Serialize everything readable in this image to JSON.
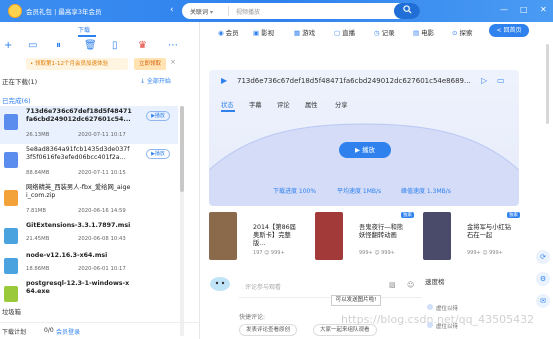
{
  "titlebar": {
    "vip_text": "会员礼包 | 最高享3年会员",
    "search_category": "关联词",
    "search_placeholder": "视频播放",
    "search_icon": "magnifier-icon",
    "min": "—",
    "max": "□",
    "close": "✕"
  },
  "left": {
    "download_tab": "下载",
    "promo_text": "• 领取第1-12个月会员加速体验",
    "promo_button": "立即领取",
    "downloading_label": "正在下载(1)",
    "start_all": "↓ 全部开始",
    "completed_label": "已完成(6)",
    "items": [
      {
        "name": "713d6e736c67def18d5f48471fa6cbd249012dc627601c54...",
        "size": "26.13MB",
        "date": "2020-07-11 10:17",
        "action": "▶播放",
        "color": "#5b8def"
      },
      {
        "name": "5e8ad8364a91fcb1435d3de037f3f5f0616fe3efed06bcc401f2a...",
        "size": "88.84MB",
        "date": "2020-07-11 10:15",
        "action": "▶播放",
        "color": "#5b8def"
      },
      {
        "name": "网络精英_西装男人-fbx_爱给网_aigei_com.zip",
        "size": "7.81MB",
        "date": "2020-06-16 14:59",
        "action": "",
        "color": "#f3a23a"
      },
      {
        "name": "GitExtensions-3.3.1.7897.msi",
        "size": "21.45MB",
        "date": "2020-06-08 10:43",
        "action": "",
        "color": "#4aa3df"
      },
      {
        "name": "node-v12.16.3-x64.msi",
        "size": "18.86MB",
        "date": "2020-06-01 10:17",
        "action": "",
        "color": "#4aa3df"
      },
      {
        "name": "postgresql-12.3-1-windows-x64.exe",
        "size": "",
        "date": "",
        "action": "",
        "color": "#9ac93b"
      }
    ],
    "trash": "垃圾箱",
    "plan": "下载计划",
    "count": "0/0",
    "login": "会员登录"
  },
  "nav": {
    "tabs": [
      "会员",
      "影视",
      "游戏",
      "直播",
      "记录",
      "电影",
      "探索"
    ],
    "back": "< 回首页"
  },
  "player": {
    "title": "713d6e736c67def18d5f48471fa6cbd249012dc627601c54e8689...",
    "tabs": [
      "状态",
      "字幕",
      "评论",
      "属性",
      "分享"
    ],
    "play": "▶ 播放",
    "stats": [
      "下载进度 100%",
      "平均速度 1MB/s",
      "峰值速度 1.3MB/s"
    ]
  },
  "posters": [
    {
      "title": "2014【第86届奥斯卡】完整版...",
      "meta": "197 ☺ 999+",
      "color": "#8a6a4a"
    },
    {
      "title": "吾鬼夜行—和熊妖怪翻转动画",
      "meta": "999+ ☺ 999+",
      "color": "#a33a3a",
      "badge": "独家"
    },
    {
      "title": "金将军与小红钻石在一起",
      "meta": "999+ ☺ 999+",
      "color": "#4a4a6a",
      "badge": "独家"
    }
  ],
  "comments": {
    "placeholder": "评论参与观看",
    "quick_label": "快捷评论:",
    "quick_items": [
      "发表评论查看原创",
      "大家一起来组队观看"
    ],
    "tooltip": "可以发送图片啦!",
    "rank_title": "速度榜",
    "rank_items": [
      "虚位以待",
      "虚位以待"
    ]
  },
  "watermark": "https://blog.csdn.net/qq_43505432"
}
